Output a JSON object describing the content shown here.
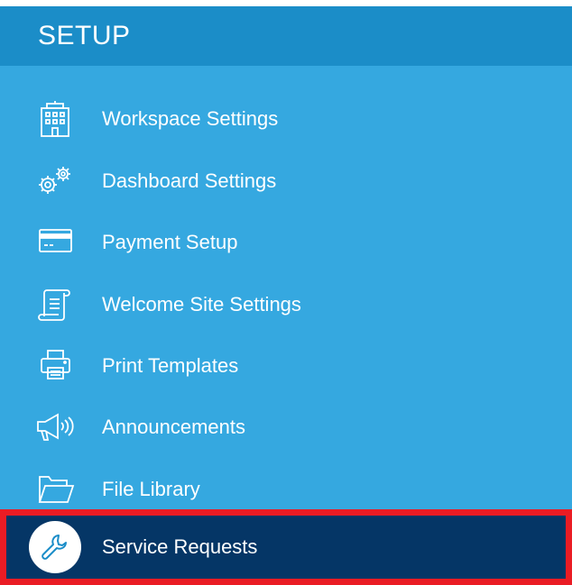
{
  "header": {
    "title": "SETUP"
  },
  "menu": {
    "items": [
      {
        "label": "Workspace Settings",
        "icon": "building-icon"
      },
      {
        "label": "Dashboard Settings",
        "icon": "gears-icon"
      },
      {
        "label": "Payment Setup",
        "icon": "credit-card-icon"
      },
      {
        "label": "Welcome Site Settings",
        "icon": "scroll-icon"
      },
      {
        "label": "Print Templates",
        "icon": "printer-icon"
      },
      {
        "label": "Announcements",
        "icon": "megaphone-icon"
      },
      {
        "label": "File Library",
        "icon": "folder-icon"
      },
      {
        "label": "Service Requests",
        "icon": "wrench-icon",
        "active": true
      }
    ]
  },
  "colors": {
    "panel": "#35a8e0",
    "header": "#1b8dc8",
    "active": "#053666",
    "highlight_border": "#ea1c24"
  }
}
